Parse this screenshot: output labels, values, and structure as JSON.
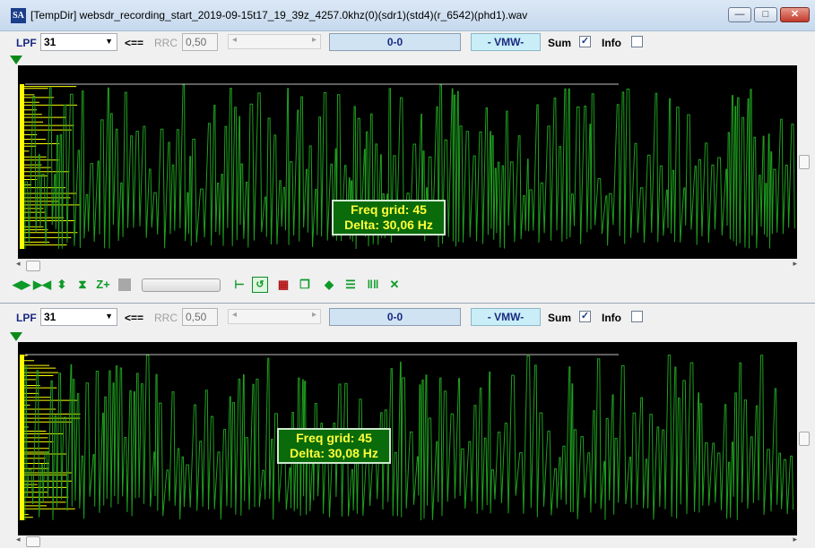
{
  "window": {
    "app_icon_text": "SA",
    "title": "[TempDir] websdr_recording_start_2019-09-15t17_19_39z_4257.0khz(0)(sdr1)(std4)(r_6542)(phd1).wav",
    "controls": {
      "minimize": "—",
      "maximize": "□",
      "close": "✕"
    }
  },
  "panels": [
    {
      "toolbar": {
        "lpf_label": "LPF",
        "lpf_value": "31",
        "arrow_label": "<==",
        "rrc_label": "RRC",
        "rrc_value": "0,50",
        "display_value": "0-0",
        "vmw_label": "- VMW-",
        "sum_label": "Sum",
        "sum_checked": "✓",
        "info_label": "Info",
        "info_checked": ""
      },
      "annotation": {
        "line1": "Freq grid: 45",
        "line2": "Delta: 30,06 Hz"
      }
    },
    {
      "toolbar": {
        "lpf_label": "LPF",
        "lpf_value": "31",
        "arrow_label": "<==",
        "rrc_label": "RRC",
        "rrc_value": "0,50",
        "display_value": "0-0",
        "vmw_label": "- VMW-",
        "sum_label": "Sum",
        "sum_checked": "✓",
        "info_label": "Info",
        "info_checked": ""
      },
      "annotation": {
        "line1": "Freq grid: 45",
        "line2": "Delta: 30,08 Hz"
      }
    }
  ],
  "icon_toolbar": {
    "icons": [
      "expand-horizontal-icon",
      "shrink-horizontal-icon",
      "expand-vertical-icon",
      "shrink-vertical-icon",
      "zoom-plus-icon",
      "stop-square-icon",
      "baseline-icon",
      "undo-icon",
      "copy-image-icon",
      "copy-data-icon",
      "diamond-icon",
      "grid-icon",
      "bars-icon",
      "cross-arrows-icon"
    ],
    "zoom_label": "Z+"
  },
  "colors": {
    "plot_bg": "#000000",
    "signal": "#1fa01f",
    "baseline": "#ffff00",
    "annotation_bg": "#0a6b0a",
    "annotation_text": "#ffff3a"
  }
}
